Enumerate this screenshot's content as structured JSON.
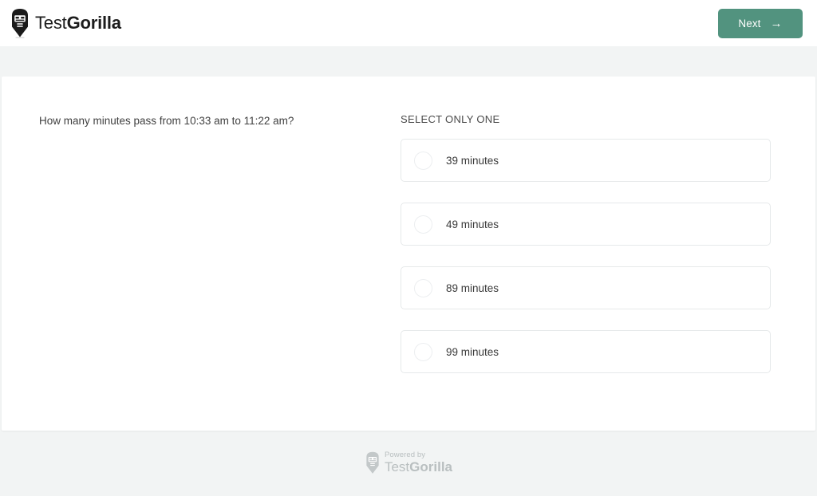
{
  "header": {
    "brand": {
      "icon": "gorilla-head-icon",
      "name_light": "Test",
      "name_bold": "Gorilla"
    },
    "next_button": {
      "label": "Next",
      "arrow": "→",
      "color": "#52937f"
    }
  },
  "main": {
    "question": "How many minutes pass from 10:33 am to 11:22 am?",
    "select_label": "SELECT ONLY ONE",
    "options": [
      {
        "label": "39 minutes",
        "selected": false
      },
      {
        "label": "49 minutes",
        "selected": false
      },
      {
        "label": "89 minutes",
        "selected": false
      },
      {
        "label": "99 minutes",
        "selected": false
      }
    ]
  },
  "footer": {
    "powered_by": "Powered by",
    "brand_light": "Test",
    "brand_bold": "Gorilla",
    "icon": "gorilla-head-icon"
  },
  "colors": {
    "page_background": "#f2f4f4",
    "card_background": "#ffffff",
    "accent_green": "#52937f",
    "option_border": "#e6e9ea",
    "muted_text": "#b9bfc0"
  }
}
